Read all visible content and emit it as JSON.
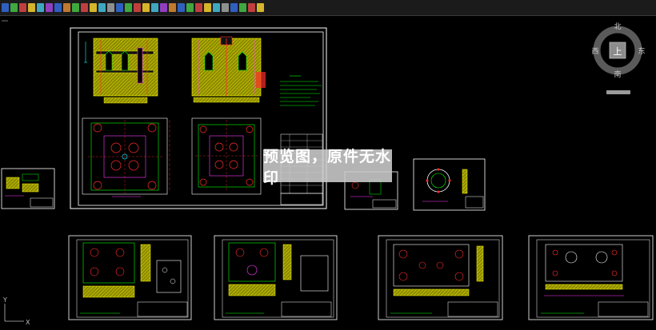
{
  "watermark": {
    "text": "预览图，原件无水印"
  },
  "viewcube": {
    "north": "北",
    "south": "南",
    "east": "东",
    "west": "西",
    "top": "上"
  },
  "ucs": {
    "y_label": "Y",
    "x_label": "X"
  },
  "colors": {
    "background": "#000000",
    "frame": "#ffffff",
    "hatch": "#b5b400",
    "green": "#00ff00",
    "red": "#ff2b2b",
    "magenta": "#ff3cff",
    "cyan": "#00e5ff",
    "yellow": "#ffff00"
  },
  "toolbar_icons": [
    "cad-tool-icon"
  ]
}
